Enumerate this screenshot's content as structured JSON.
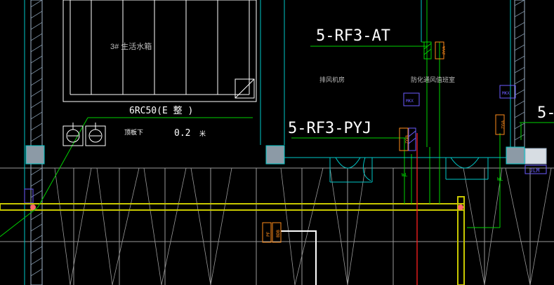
{
  "drawing": {
    "background": "#000000",
    "labels": {
      "tag_at": "5-RF3-AT",
      "tag_pyj": "5-RF3-PYJ",
      "tag_edge": "5-",
      "pipe_spec": "6RC50(E 整 )",
      "tank": "3# 生活水箱",
      "fan_room": "排风机房",
      "smoke_room": "防化通风值班室",
      "valve_note": "顶板下",
      "depth_value": "0.2",
      "depth_unit": "米",
      "mkx_left": "MKX",
      "mkx_right": "MKX",
      "box_pf": "PF",
      "box_btn": "BDB",
      "jlm": "JLM",
      "vert_mid": "ZYVA",
      "vert_top": "ZYVA",
      "vert_right": "ZYVA",
      "wire_tag_1": "WL",
      "wire_tag_2": "WL"
    },
    "colors": {
      "grid": "#a9a9a9",
      "white": "#ffffff",
      "green": "#00d200",
      "yellow": "#c8c800",
      "cyan": "#00c8c8",
      "red": "#ff2020",
      "orange": "#ff8c1a",
      "purple": "#6b5cff",
      "column_fill": "#8c9aa6"
    }
  }
}
